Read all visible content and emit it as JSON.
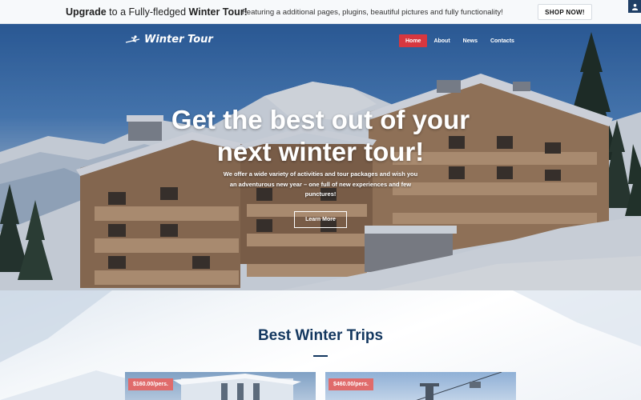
{
  "promo": {
    "upgrade_prefix": "Upgrade",
    "upgrade_middle": " to a Fully-fledged ",
    "upgrade_bold": "Winter Tour!",
    "features": "Featuring a additional pages, plugins, beautiful pictures and fully functionality!",
    "shop_label": "SHOP NOW!"
  },
  "header": {
    "logo_text": "Winter Tour",
    "nav": [
      {
        "label": "Home",
        "active": true
      },
      {
        "label": "About",
        "active": false
      },
      {
        "label": "News",
        "active": false
      },
      {
        "label": "Contacts",
        "active": false
      }
    ]
  },
  "hero": {
    "title_line1": "Get the best out of your",
    "title_line2": "next winter tour!",
    "subtitle": "We offer a wide variety of activities and tour packages and wish you an adventurous new year – one full of new experiences and few punctures!",
    "cta_label": "Learn More"
  },
  "trips": {
    "title": "Best Winter Trips",
    "cards": [
      {
        "price": "$160.00/pers."
      },
      {
        "price": "$460.00/pers."
      }
    ]
  },
  "colors": {
    "accent": "#d7373f",
    "navy": "#13375f",
    "price_badge": "#e06b6b"
  }
}
